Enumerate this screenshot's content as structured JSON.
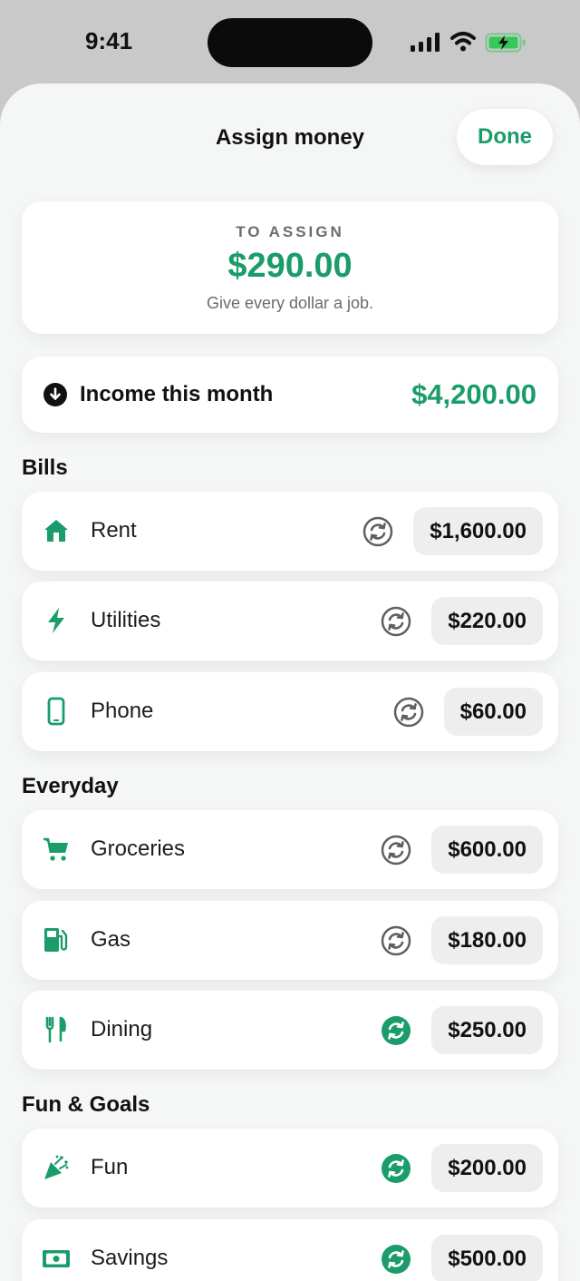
{
  "status_bar": {
    "time": "9:41"
  },
  "sheet": {
    "title": "Assign money",
    "done_label": "Done"
  },
  "to_assign": {
    "label": "TO ASSIGN",
    "amount": "$290.00",
    "subtitle": "Give every dollar a job."
  },
  "income": {
    "label": "Income this month",
    "amount": "$4,200.00"
  },
  "sections": [
    {
      "title": "Bills",
      "items": [
        {
          "label": "Rent",
          "amount": "$1,600.00",
          "icon": "house-icon",
          "recurring_active": false
        },
        {
          "label": "Utilities",
          "amount": "$220.00",
          "icon": "bolt-icon",
          "recurring_active": false
        },
        {
          "label": "Phone",
          "amount": "$60.00",
          "icon": "phone-icon",
          "recurring_active": false
        }
      ]
    },
    {
      "title": "Everyday",
      "items": [
        {
          "label": "Groceries",
          "amount": "$600.00",
          "icon": "cart-icon",
          "recurring_active": false
        },
        {
          "label": "Gas",
          "amount": "$180.00",
          "icon": "fuel-pump-icon",
          "recurring_active": false
        },
        {
          "label": "Dining",
          "amount": "$250.00",
          "icon": "fork-knife-icon",
          "recurring_active": true
        }
      ]
    },
    {
      "title": "Fun & Goals",
      "items": [
        {
          "label": "Fun",
          "amount": "$200.00",
          "icon": "party-popper-icon",
          "recurring_active": true
        },
        {
          "label": "Savings",
          "amount": "$500.00",
          "icon": "banknote-icon",
          "recurring_active": true
        }
      ]
    }
  ],
  "colors": {
    "accent": "#1a9c6b",
    "inactive_icon": "#5f5f63",
    "background": "#f5f6f6"
  }
}
